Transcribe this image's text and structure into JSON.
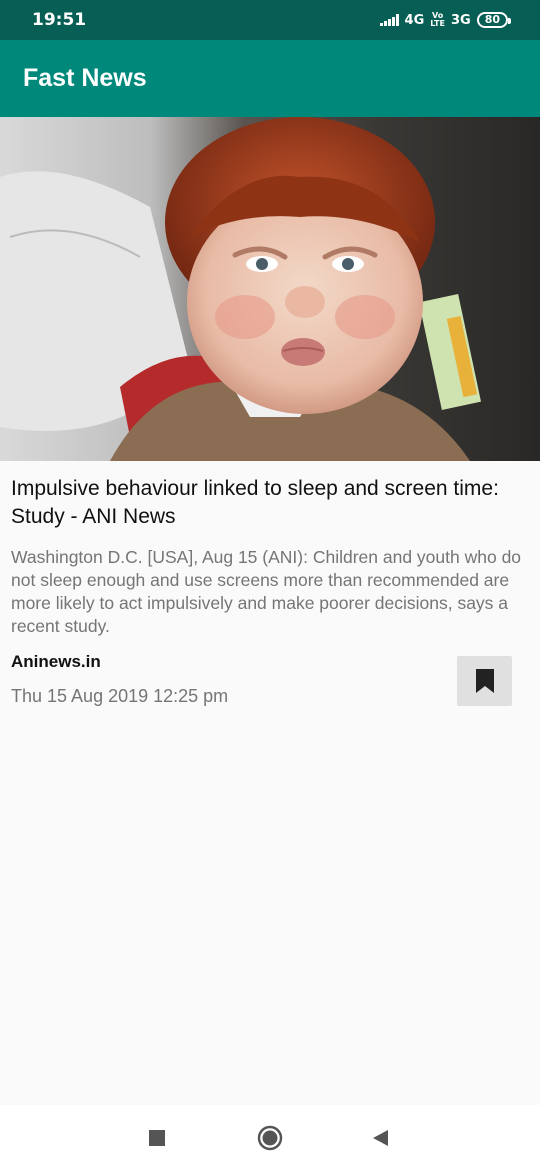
{
  "status_bar": {
    "time": "19:51",
    "network_1": "4G",
    "volte_line1": "Vo",
    "volte_line2": "LTE",
    "network_2": "3G",
    "battery": "80"
  },
  "app_bar": {
    "title": "Fast News"
  },
  "article": {
    "image_alt": "Photo of a frowning red-haired child",
    "headline": "Impulsive behaviour linked to sleep and screen time: Study - ANI News",
    "description": "Washington D.C. [USA], Aug 15 (ANI): Children and youth who do not sleep enough and use screens more than recommended are more likely to act impulsively and make poorer decisions, says a recent study.",
    "source": "Aninews.in",
    "date": "Thu 15 Aug 2019 12:25 pm"
  },
  "icons": {
    "bookmark": "bookmark-icon",
    "recents": "square-icon",
    "home": "circle-icon",
    "back": "triangle-back-icon"
  },
  "colors": {
    "status_bar": "#075e54",
    "app_bar": "#00897b",
    "background": "#fafafa"
  }
}
